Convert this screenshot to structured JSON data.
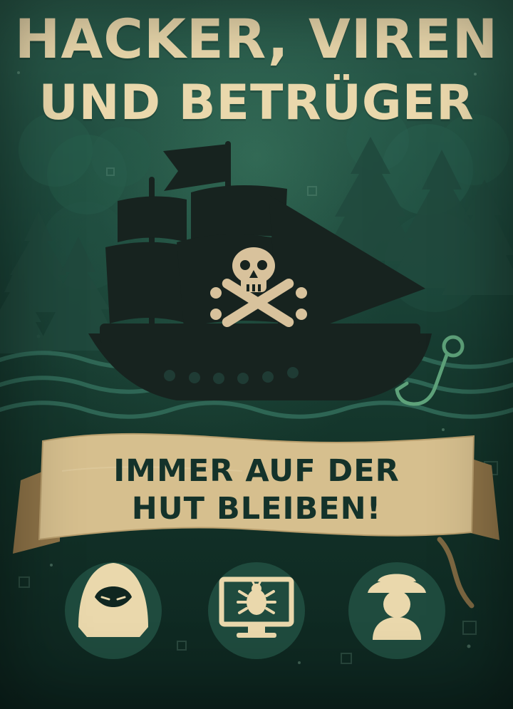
{
  "title": {
    "line1": "HACKER, VIREN",
    "line2": "UND BETRÜGER"
  },
  "banner": {
    "line1": "IMMER AUF DER",
    "line2": "HUT BLEIBEN!"
  },
  "colors": {
    "background_top": "#2a5b4b",
    "background_bottom": "#0d251f",
    "title": "#ead8ac",
    "banner": "#d6bf8e",
    "banner_text": "#14322a",
    "ship": "#17231f",
    "accent": "#5ea27a"
  },
  "icons": {
    "ship": "pirate-ship-icon",
    "fish_hook": "fish-hook-icon",
    "hacker": "hooded-hacker-icon",
    "virus": "computer-virus-icon",
    "scammer": "scammer-hat-icon"
  }
}
